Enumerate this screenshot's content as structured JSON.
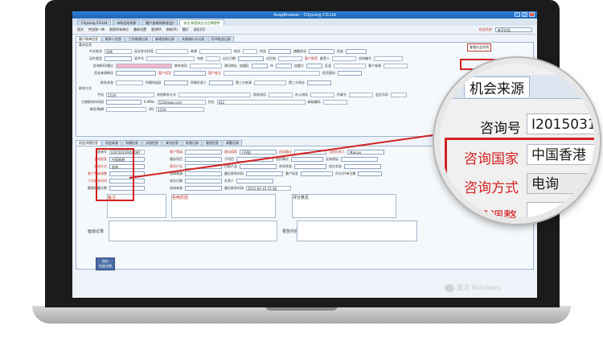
{
  "browser": {
    "title": "AsapBrowser - CityLong CO.Ltd",
    "window_controls": [
      "–",
      "□",
      "×"
    ],
    "tabs": [
      {
        "label": "CityLong CO.Ltd",
        "active": false
      },
      {
        "label": "市场活动列表",
        "active": false
      },
      {
        "label": "客户咨询列表(机会)",
        "active": false
      },
      {
        "label": "安全-新民私企业品牌提供",
        "active": true
      }
    ]
  },
  "toolbar": {
    "items": [
      "提交",
      "传送到一审",
      "搜索所有单位",
      "重新设置",
      "更改PA",
      "刷新(R)",
      "翻打",
      "退出(Q)"
    ],
    "status_label": "机会状态:",
    "status_value": "新开机会"
  },
  "subtabs": [
    "客户询单信息",
    "联系人信息",
    "工作联络记录",
    "新增咨询记录",
    "关键询价计记录",
    "D.M发送记录"
  ],
  "form": {
    "section_basic": "基本信息",
    "chinese_name_label": "中文姓名",
    "chinese_name_value": "吴超",
    "english_name_label": "英文姓名拼音",
    "title_label": "称谓",
    "surname_label": "姓氏",
    "gender_label": "性别",
    "marital_label": "婚姻状况",
    "nationality_label": "民族",
    "id_type_label": "证件类型",
    "id_no_label": "证件号",
    "age_label": "年龄",
    "birthday_label": "出生日期",
    "birthplace_label": "出生地",
    "customer_status_label": "客户推荐",
    "referrer_label": "推荐人",
    "contract_label": "合同编号",
    "consultant_label": "咨询顾问/最后",
    "company_label": "联系电话",
    "address_label": "通讯地址",
    "province_label": "加盟区",
    "city_label": "市",
    "country_label": "加盟大",
    "zip_label": "区县",
    "customer_origin_label": "客户来源",
    "source_label": "资金来源情况",
    "customer_type_label": "客户类型",
    "remark_label": "客户备注",
    "invest_label": "投资意向",
    "contact_status_label": "联系状态",
    "focus_label": "所属利益区",
    "source_person_label": "所属负责人",
    "third_party_label": "第三方来源",
    "fourth_label": "第三方承办",
    "section_contact": "联系方式",
    "phone_label": "手机",
    "phone_value": "1234",
    "other_phone_label": "其他联系方式",
    "home_phone_label": "家庭电话",
    "office_phone_label": "办公电话",
    "fax_label": "传真号",
    "member_label": "会员号码",
    "company_ext_label": "方便联系时间段",
    "email_label": "E-MAIL",
    "email_value": "1234@qq.com",
    "address2_label": "住址",
    "address2_value": "412",
    "postal_label": "邮政编码",
    "wechat_label": "微信/微博",
    "qq_label": "QQ",
    "qq_value": "1234",
    "confirm_button": "查看社会合同",
    "cancel_checkbox": "取消签约"
  },
  "lower_tabs": [
    "机会详细信息",
    "机会来源",
    "沟通信息",
    "文档信息",
    "来访信息",
    "处理记录",
    "跟进信息",
    "调看记录"
  ],
  "opportunity": {
    "inquiry_no_label": "咨询号",
    "inquiry_no_value": "I20150310000087",
    "inquiry_country_label": "咨询国家",
    "inquiry_country_value": "中国香港",
    "inquiry_method_label": "咨询方式",
    "inquiry_method_value": "电询",
    "level_adjust_label": "客户等级调整",
    "next_contact_label": "下次联系时间",
    "remind_label": "跟踪提醒天数",
    "customer_level_label": "客户等级",
    "service_label": "服务项目",
    "intention_label": "意向国家",
    "intention_value": "[不限]",
    "sub_product_label": "意向产品",
    "sub_item_label": "子项目",
    "current_product_label": "目前产品",
    "visitor_level_label": "咨询来源",
    "latest_contact_label": "最后联系时间",
    "latest_value": "2015-03-10 15:36",
    "stage_label": "阶段情况",
    "payment_label": "签约情况",
    "case_status_label": "合同状态",
    "current_person_label": "当前负责人",
    "current_person_value": "Marcus",
    "origin_reason_label": "无效原因",
    "deal_label": "成交状态",
    "deal_date_label": "成交日期",
    "hold_person_label": "负责人",
    "tag_label": "客户标签",
    "eval_label": "评分/开单日期",
    "memo_label": "备注",
    "fail_reason_label": "拒绝原因",
    "summary_label": "评分意见",
    "interview_label": "面谈记录",
    "report_label": "报告内容",
    "save_button": "保存\n机会详情"
  },
  "zoom": {
    "tab_left": "息",
    "tab_right": "机会来源",
    "inquiry_no_label": "咨询号",
    "inquiry_no_value": "I20150310",
    "inquiry_country_label": "咨询国家",
    "inquiry_country_value": "中国香港",
    "inquiry_method_label": "咨询方式",
    "inquiry_method_value": "电询",
    "level_adjust_label": "等级调整"
  },
  "watermark": "激活 Windows",
  "colors": {
    "accent_red": "#d32121",
    "titlebar_blue": "#1f65b8",
    "screen_bg": "#eef3f9"
  }
}
